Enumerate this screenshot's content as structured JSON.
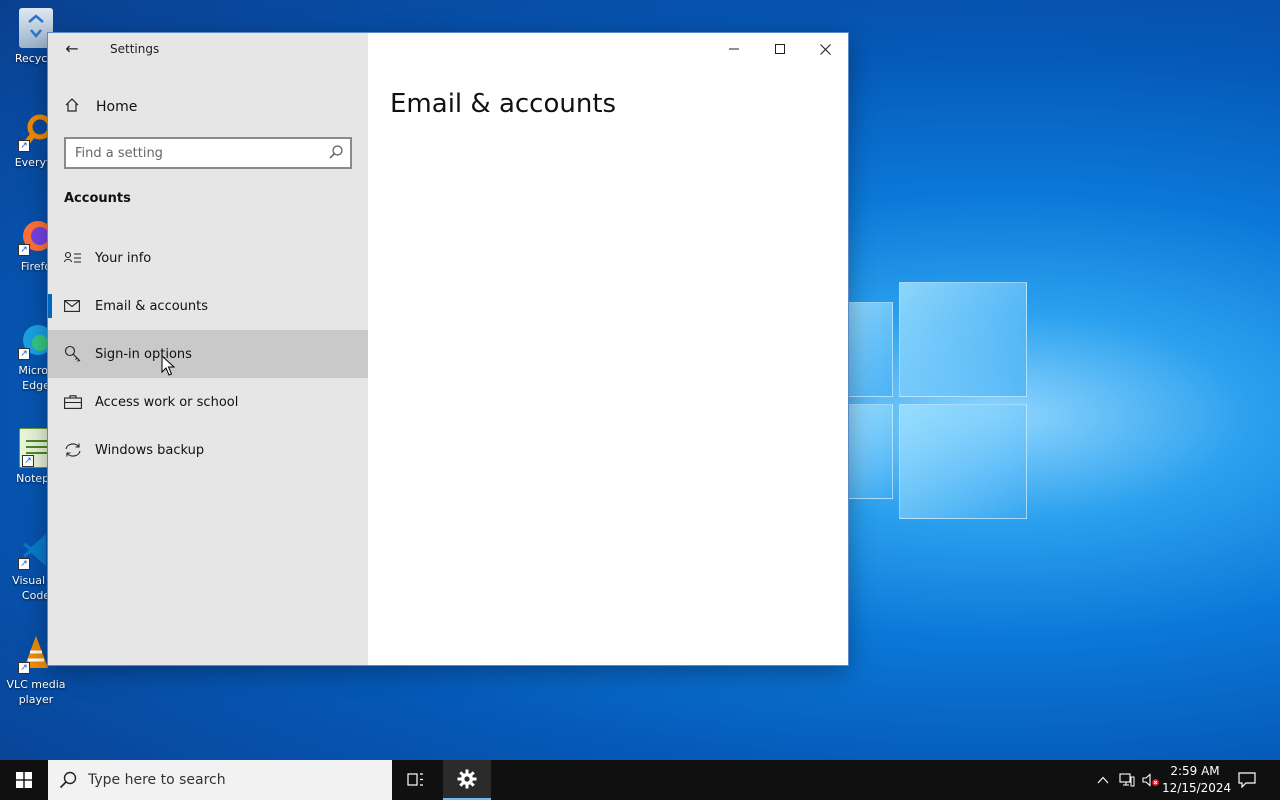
{
  "desktop": {
    "icons": [
      {
        "label": "Recycle"
      },
      {
        "label": "Everyth"
      },
      {
        "label": "Firefo"
      },
      {
        "label": "Micros Edge"
      },
      {
        "label": "Notepa"
      },
      {
        "label": "Visual St Code"
      },
      {
        "label": "VLC media player"
      }
    ]
  },
  "window": {
    "title": "Settings",
    "home_label": "Home",
    "search_placeholder": "Find a setting",
    "section_title": "Accounts",
    "nav_items": [
      {
        "label": "Your info"
      },
      {
        "label": "Email & accounts"
      },
      {
        "label": "Sign-in options"
      },
      {
        "label": "Access work or school"
      },
      {
        "label": "Windows backup"
      }
    ],
    "selected_item": "Email & accounts",
    "hovered_item": "Sign-in options",
    "page_title": "Email & accounts"
  },
  "taskbar": {
    "search_placeholder": "Type here to search",
    "time": "2:59 AM",
    "date": "12/15/2024"
  },
  "colors": {
    "accent": "#0067c0",
    "sidebar_bg": "#e6e6e6",
    "hover_bg": "#c9c9c9",
    "taskbar_bg": "#101010"
  }
}
